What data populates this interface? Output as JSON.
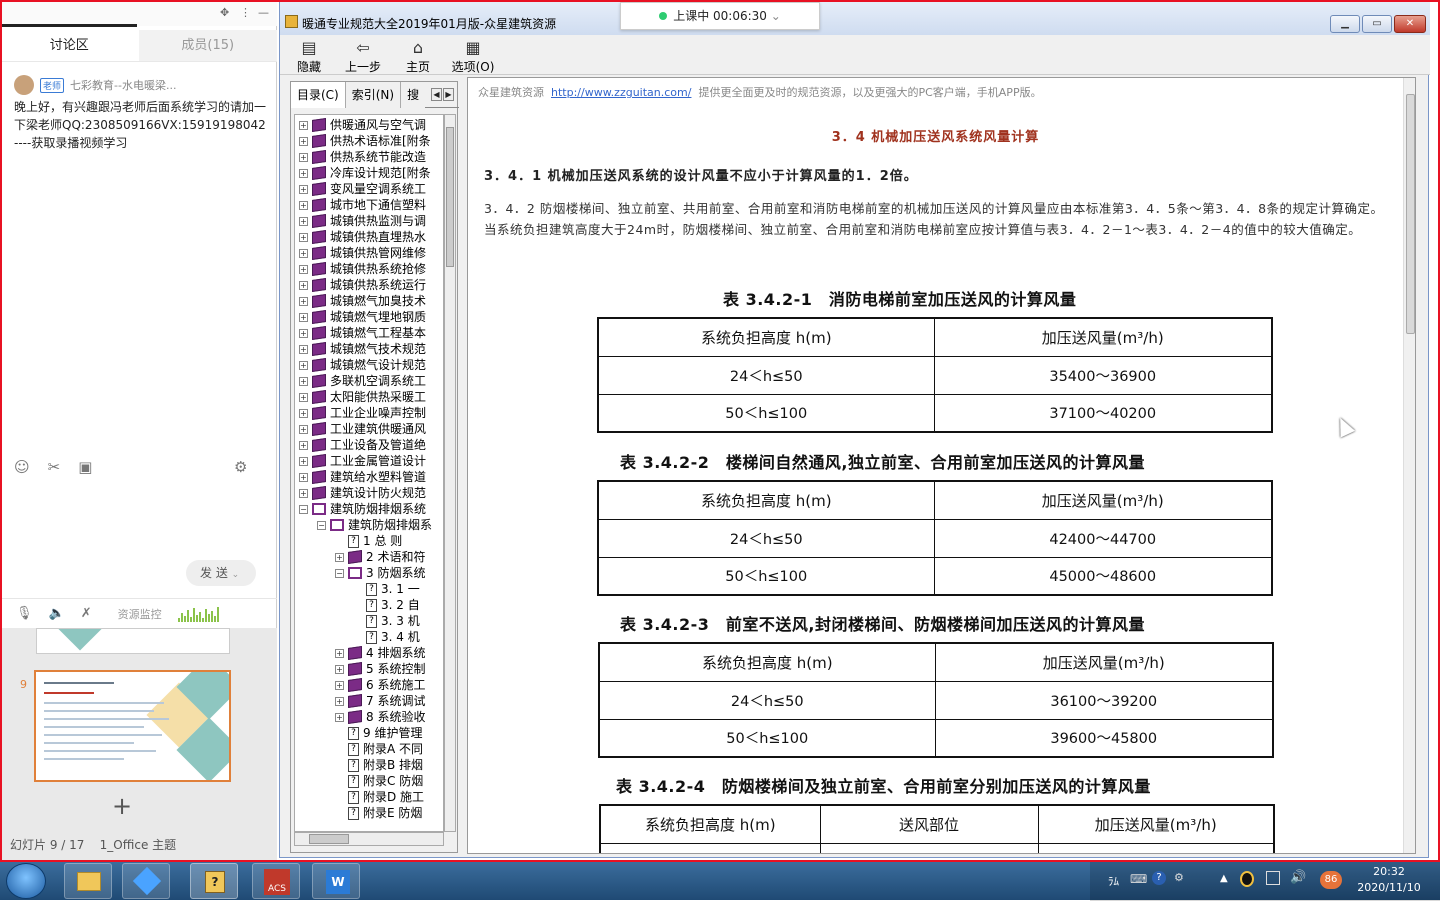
{
  "chat": {
    "tabs": [
      "讨论区",
      "成员(15)"
    ],
    "controls": [
      "✥",
      "⋮",
      "—"
    ],
    "sender": "七彩教育--水电暖梁...",
    "sender_tag": "老师",
    "message": "晚上好，有兴趣跟冯老师后面系统学习的请加一下梁老师QQ:2308509166VX:15919198042----获取录播视频学习",
    "send_label": "发 送",
    "monitor_label": "资源监控",
    "icons": [
      "smile-icon",
      "scissors-icon",
      "image-icon",
      "settings-icon",
      "mic-icon",
      "speaker-icon",
      "mute-icon"
    ]
  },
  "slides": {
    "current_number": "9",
    "status": "幻灯片 9 / 17",
    "theme": "1_Office 主题"
  },
  "live_badge": {
    "text": "上课中 00:06:30",
    "dot_color": "#2ecc71"
  },
  "app": {
    "title": "暖通专业规范大全2019年01月版-众星建筑资源",
    "toolbar": [
      {
        "label": "隐藏",
        "icon": "hide-icon"
      },
      {
        "label": "上一步",
        "icon": "back-icon"
      },
      {
        "label": "主页",
        "icon": "home-icon"
      },
      {
        "label": "选项(O)",
        "icon": "options-icon"
      }
    ],
    "nav_tabs": [
      "目录(C)",
      "索引(N)",
      "搜"
    ],
    "tree": [
      {
        "label": "供暖通风与空气调",
        "kind": "book",
        "level": 0,
        "exp": "+"
      },
      {
        "label": "供热术语标准[附条",
        "kind": "book",
        "level": 0,
        "exp": "+"
      },
      {
        "label": "供热系统节能改造",
        "kind": "book",
        "level": 0,
        "exp": "+"
      },
      {
        "label": "冷库设计规范[附条",
        "kind": "book",
        "level": 0,
        "exp": "+"
      },
      {
        "label": "变风量空调系统工",
        "kind": "book",
        "level": 0,
        "exp": "+"
      },
      {
        "label": "城市地下通信塑料",
        "kind": "book",
        "level": 0,
        "exp": "+"
      },
      {
        "label": "城镇供热监测与调",
        "kind": "book",
        "level": 0,
        "exp": "+"
      },
      {
        "label": "城镇供热直埋热水",
        "kind": "book",
        "level": 0,
        "exp": "+"
      },
      {
        "label": "城镇供热管网维修",
        "kind": "book",
        "level": 0,
        "exp": "+"
      },
      {
        "label": "城镇供热系统抢修",
        "kind": "book",
        "level": 0,
        "exp": "+"
      },
      {
        "label": "城镇供热系统运行",
        "kind": "book",
        "level": 0,
        "exp": "+"
      },
      {
        "label": "城镇燃气加臭技术",
        "kind": "book",
        "level": 0,
        "exp": "+"
      },
      {
        "label": "城镇燃气埋地钢质",
        "kind": "book",
        "level": 0,
        "exp": "+"
      },
      {
        "label": "城镇燃气工程基本",
        "kind": "book",
        "level": 0,
        "exp": "+"
      },
      {
        "label": "城镇燃气技术规范",
        "kind": "book",
        "level": 0,
        "exp": "+"
      },
      {
        "label": "城镇燃气设计规范",
        "kind": "book",
        "level": 0,
        "exp": "+"
      },
      {
        "label": "多联机空调系统工",
        "kind": "book",
        "level": 0,
        "exp": "+"
      },
      {
        "label": "太阳能供热采暖工",
        "kind": "book",
        "level": 0,
        "exp": "+"
      },
      {
        "label": "工业企业噪声控制",
        "kind": "book",
        "level": 0,
        "exp": "+"
      },
      {
        "label": "工业建筑供暖通风",
        "kind": "book",
        "level": 0,
        "exp": "+"
      },
      {
        "label": "工业设备及管道绝",
        "kind": "book",
        "level": 0,
        "exp": "+"
      },
      {
        "label": "工业金属管道设计",
        "kind": "book",
        "level": 0,
        "exp": "+"
      },
      {
        "label": "建筑给水塑料管道",
        "kind": "book",
        "level": 0,
        "exp": "+"
      },
      {
        "label": "建筑设计防火规范",
        "kind": "book",
        "level": 0,
        "exp": "+"
      },
      {
        "label": "建筑防烟排烟系统",
        "kind": "bookopen",
        "level": 0,
        "exp": "−"
      },
      {
        "label": "建筑防烟排烟系",
        "kind": "bookopen",
        "level": 1,
        "exp": "−"
      },
      {
        "label": "1 总 则",
        "kind": "page",
        "level": 2,
        "exp": ""
      },
      {
        "label": "2 术语和符",
        "kind": "book",
        "level": 2,
        "exp": "+"
      },
      {
        "label": "3 防烟系统",
        "kind": "bookopen",
        "level": 2,
        "exp": "−"
      },
      {
        "label": "3. 1 一",
        "kind": "page",
        "level": 3,
        "exp": ""
      },
      {
        "label": "3. 2 自",
        "kind": "page",
        "level": 3,
        "exp": ""
      },
      {
        "label": "3. 3 机",
        "kind": "page",
        "level": 3,
        "exp": ""
      },
      {
        "label": "3. 4 机",
        "kind": "page",
        "level": 3,
        "exp": ""
      },
      {
        "label": "4 排烟系统",
        "kind": "book",
        "level": 2,
        "exp": "+"
      },
      {
        "label": "5 系统控制",
        "kind": "book",
        "level": 2,
        "exp": "+"
      },
      {
        "label": "6 系统施工",
        "kind": "book",
        "level": 2,
        "exp": "+"
      },
      {
        "label": "7 系统调试",
        "kind": "book",
        "level": 2,
        "exp": "+"
      },
      {
        "label": "8 系统验收",
        "kind": "book",
        "level": 2,
        "exp": "+"
      },
      {
        "label": "9 维护管理",
        "kind": "page",
        "level": 2,
        "exp": ""
      },
      {
        "label": "附录A 不同",
        "kind": "page",
        "level": 2,
        "exp": ""
      },
      {
        "label": "附录B 排烟",
        "kind": "page",
        "level": 2,
        "exp": ""
      },
      {
        "label": "附录C 防烟",
        "kind": "page",
        "level": 2,
        "exp": ""
      },
      {
        "label": "附录D 施工",
        "kind": "page",
        "level": 2,
        "exp": ""
      },
      {
        "label": "附录E 防烟",
        "kind": "page",
        "level": 2,
        "exp": ""
      }
    ]
  },
  "doc": {
    "source_note": "众星建筑资源",
    "source_link": "http://www.zzguitan.com/",
    "source_note_tail": "提供更全面更及时的规范资源，以及更强大的PC客户端，手机APP版。",
    "section_title": "3．4 机械加压送风系统风量计算",
    "clause_341": "3．4．1 机械加压送风系统的设计风量不应小于计算风量的1．2倍。",
    "clause_342": "3．4．2 防烟楼梯间、独立前室、共用前室、合用前室和消防电梯前室的机械加压送风的计算风量应由本标准第3．4．5条～第3．4．8条的规定计算确定。当系统负担建筑高度大于24m时，防烟楼梯间、独立前室、合用前室和消防电梯前室应按计算值与表3．4．2－1～表3．4．2－4的值中的较大值确定。",
    "header_height": "系统负担高度 h(m)",
    "header_air": "加压送风量(m³/h)",
    "header_part": "送风部位",
    "table1": {
      "caption": "表 3.4.2-1　消防电梯前室加压送风的计算风量",
      "rows": [
        [
          "24＜h≤50",
          "35400～36900"
        ],
        [
          "50＜h≤100",
          "37100～40200"
        ]
      ]
    },
    "table2": {
      "caption": "表 3.4.2-2　楼梯间自然通风,独立前室、合用前室加压送风的计算风量",
      "rows": [
        [
          "24＜h≤50",
          "42400～44700"
        ],
        [
          "50＜h≤100",
          "45000～48600"
        ]
      ]
    },
    "table3": {
      "caption": "表 3.4.2-3　前室不送风,封闭楼梯间、防烟楼梯间加压送风的计算风量",
      "rows": [
        [
          "24＜h≤50",
          "36100～39200"
        ],
        [
          "50＜h≤100",
          "39600～45800"
        ]
      ]
    },
    "table4": {
      "caption": "表 3.4.2-4　防烟楼梯间及独立前室、合用前室分别加压送风的计算风量"
    }
  },
  "taskbar": {
    "apps": [
      "file-explorer-icon",
      "app-blue-icon",
      "help-icon",
      "acs-icon",
      "wps-icon"
    ],
    "tray_lang": "ﾗﾑ",
    "badge": "86",
    "time": "20:32",
    "date": "2020/11/10"
  }
}
